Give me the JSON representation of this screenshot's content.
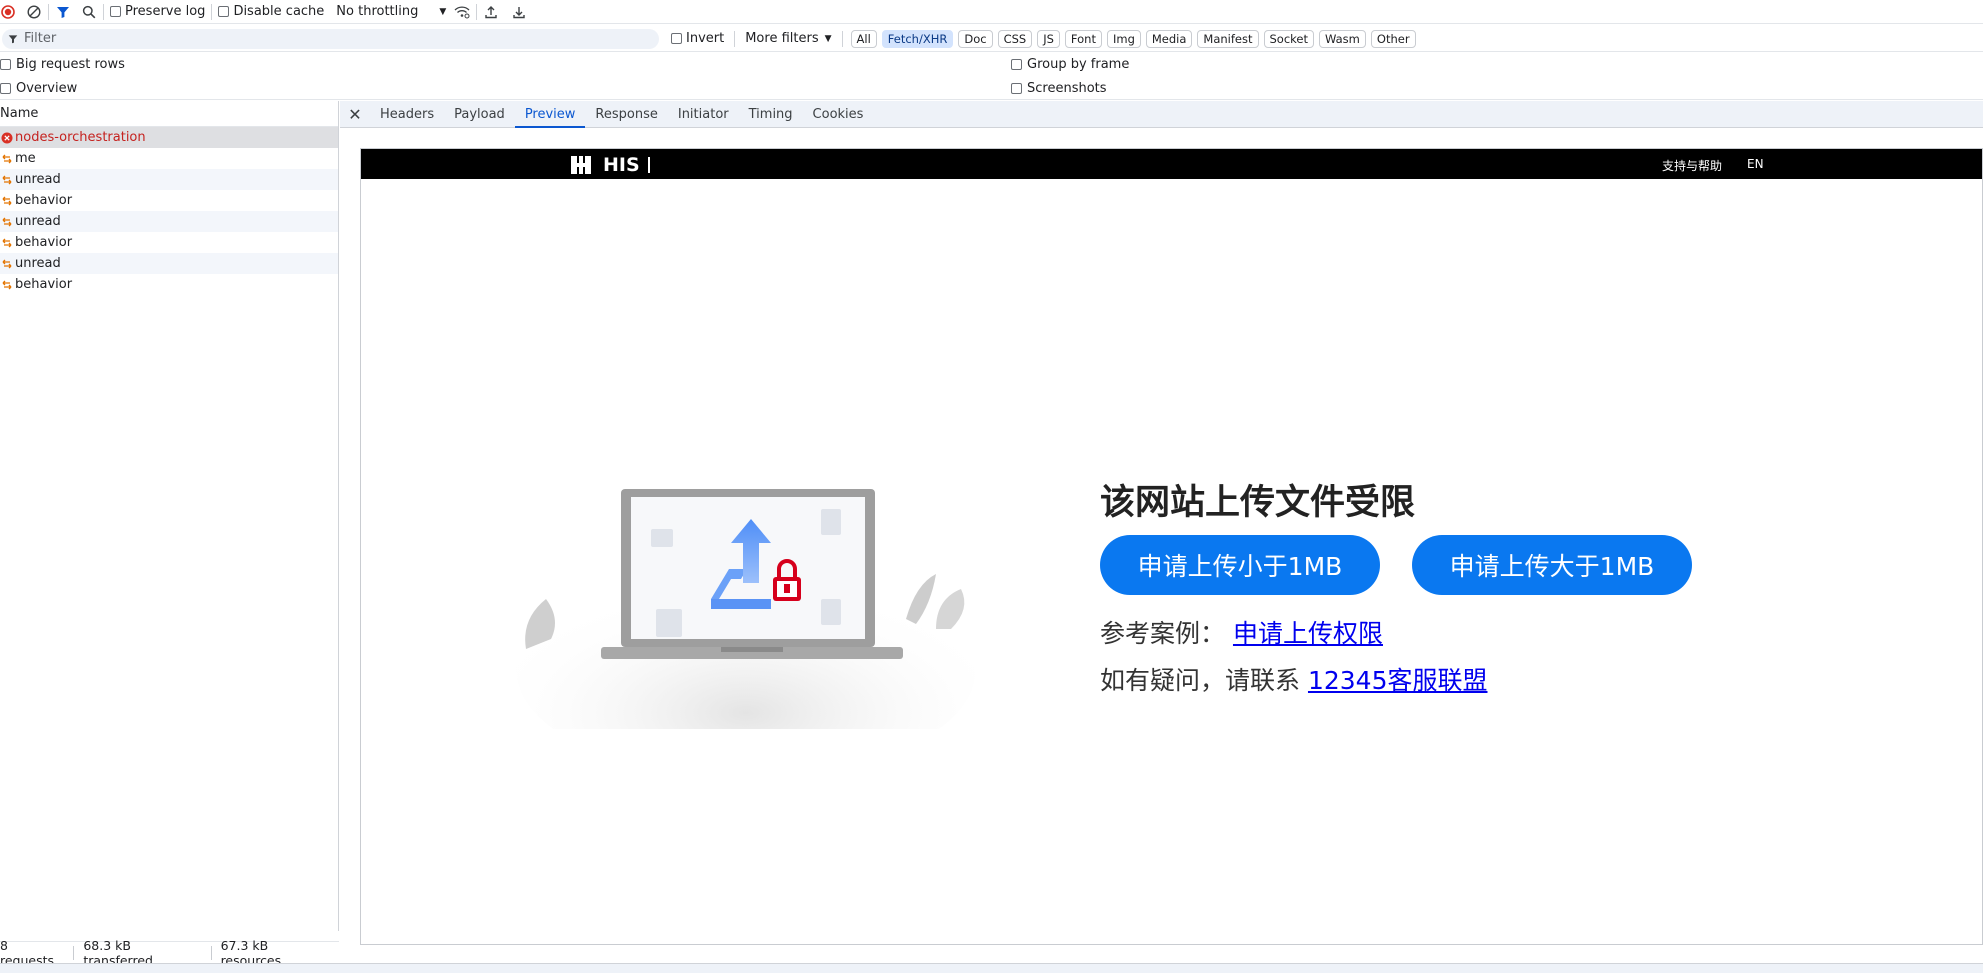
{
  "toolbar": {
    "preserve_log": "Preserve log",
    "disable_cache": "Disable cache",
    "throttling": "No throttling"
  },
  "filter": {
    "placeholder": "Filter",
    "invert": "Invert",
    "more_filters": "More filters",
    "chips": [
      "All",
      "Fetch/XHR",
      "Doc",
      "CSS",
      "JS",
      "Font",
      "Img",
      "Media",
      "Manifest",
      "Socket",
      "Wasm",
      "Other"
    ],
    "active_chip": "Fetch/XHR"
  },
  "options": {
    "big_request_rows": "Big request rows",
    "overview": "Overview",
    "group_by_frame": "Group by frame",
    "screenshots": "Screenshots"
  },
  "requests": {
    "column_name": "Name",
    "items": [
      {
        "name": "nodes-orchestration",
        "status": "error"
      },
      {
        "name": "me",
        "status": "xhr"
      },
      {
        "name": "unread",
        "status": "xhr"
      },
      {
        "name": "behavior",
        "status": "xhr"
      },
      {
        "name": "unread",
        "status": "xhr"
      },
      {
        "name": "behavior",
        "status": "xhr"
      },
      {
        "name": "unread",
        "status": "xhr"
      },
      {
        "name": "behavior",
        "status": "xhr"
      }
    ]
  },
  "footer": {
    "requests": "8 requests",
    "transferred": "68.3 kB transferred",
    "resources": "67.3 kB resources"
  },
  "detail_tabs": [
    "Headers",
    "Payload",
    "Preview",
    "Response",
    "Initiator",
    "Timing",
    "Cookies"
  ],
  "active_tab": "Preview",
  "preview": {
    "logo_text": "HIS",
    "header_links": [
      "支持与帮助",
      "EN"
    ],
    "headline": "该网站上传文件受限",
    "button_small": "申请上传小于1MB",
    "button_large": "申请上传大于1MB",
    "ref_label": "参考案例：",
    "ref_link": "申请上传权限",
    "contact_label": "如有疑问，请联系",
    "contact_link": "12345客服联盟",
    "button_color": "#0a78f0",
    "art_icon": "upload-locked-laptop-illustration"
  }
}
